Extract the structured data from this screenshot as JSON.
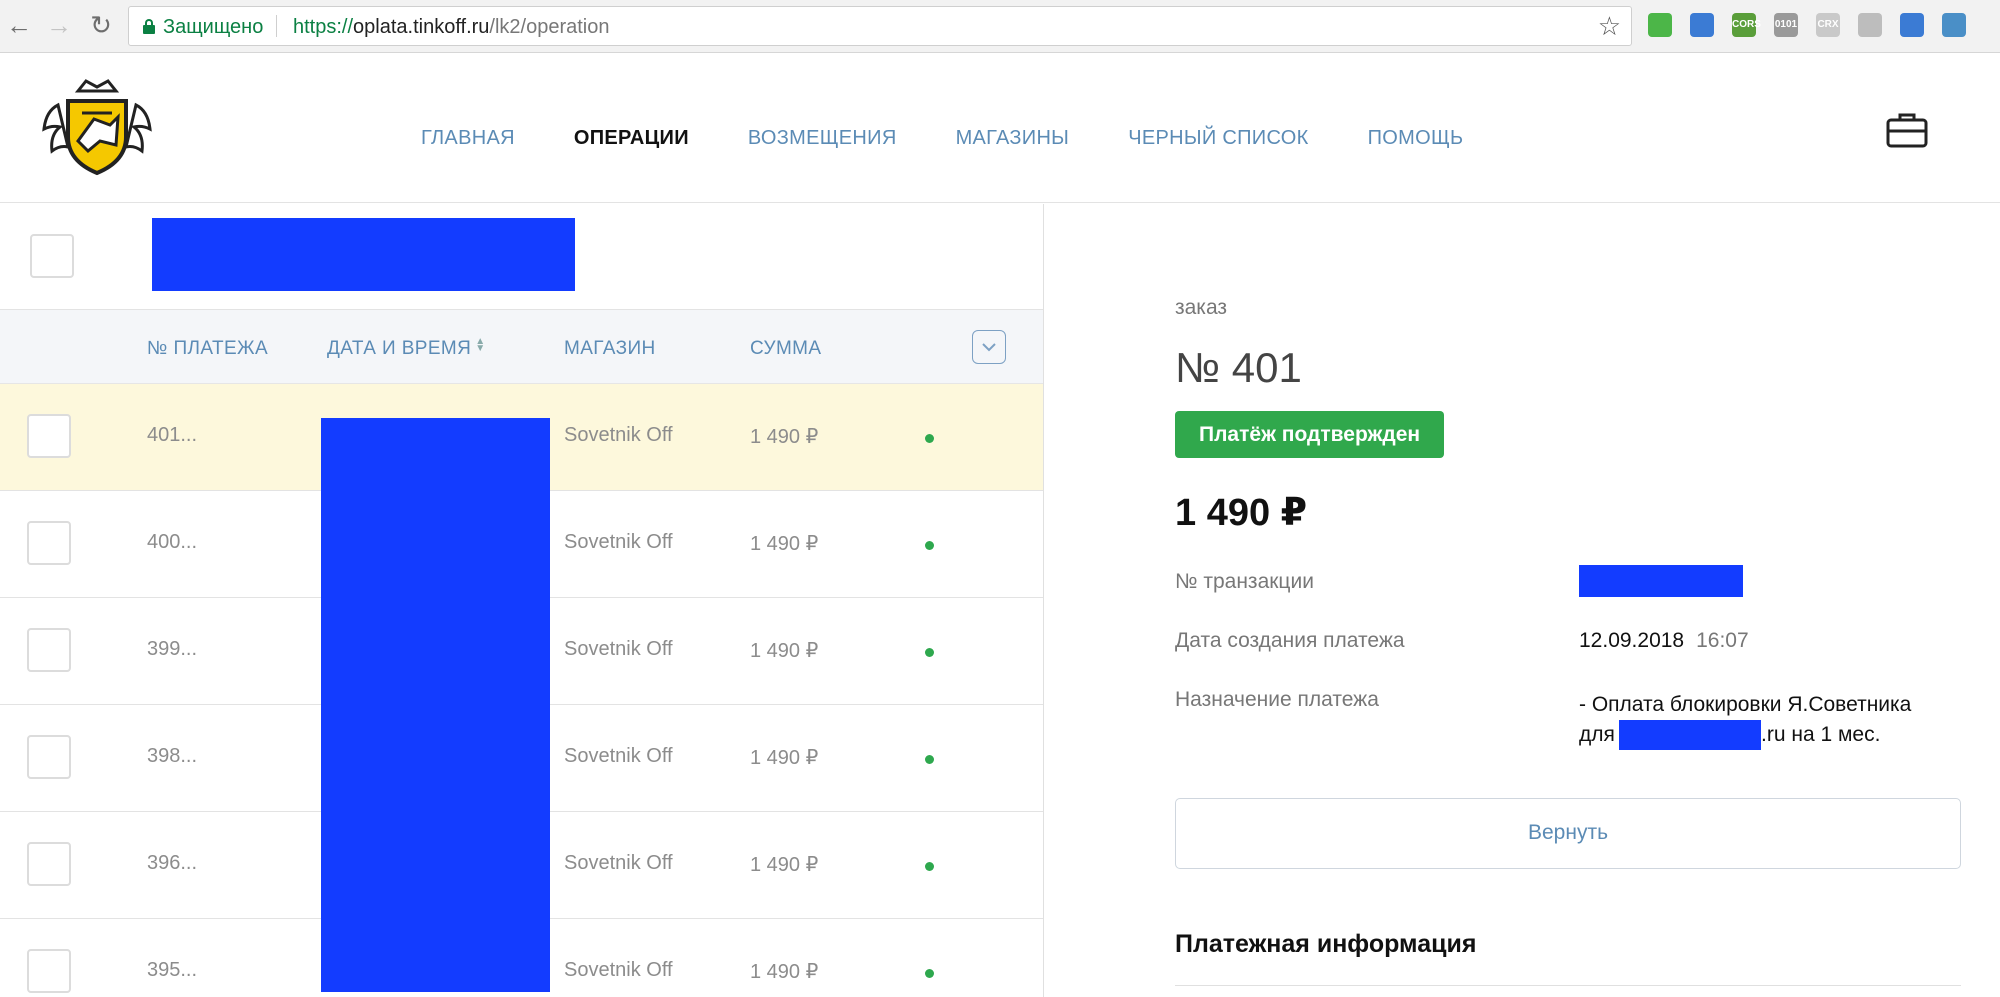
{
  "browser": {
    "secure_label": "Защищено",
    "url_scheme": "https://",
    "url_host": "oplata.tinkoff.ru",
    "url_path": "/lk2/operation",
    "extensions": [
      {
        "name": "green-extension-icon",
        "color": "#4cb648",
        "text": ""
      },
      {
        "name": "blue-block-extension-icon",
        "color": "#3b7bd4",
        "text": ""
      },
      {
        "name": "cors-extension-icon",
        "color": "#5a9e3a",
        "text": "CORS"
      },
      {
        "name": "binary-extension-icon",
        "color": "#9a9a9a",
        "text": "0101"
      },
      {
        "name": "crx-extension-icon",
        "color": "#c9c9c9",
        "text": "CRX"
      },
      {
        "name": "paw-extension-icon",
        "color": "#bdbdbd",
        "text": ""
      },
      {
        "name": "cart-extension-icon",
        "color": "#3b7bd4",
        "text": ""
      },
      {
        "name": "drop-extension-icon",
        "color": "#4a8fc7",
        "text": ""
      }
    ]
  },
  "header": {
    "nav": [
      {
        "label": "ГЛАВНАЯ",
        "active": false
      },
      {
        "label": "ОПЕРАЦИИ",
        "active": true
      },
      {
        "label": "ВОЗМЕЩЕНИЯ",
        "active": false
      },
      {
        "label": "МАГАЗИНЫ",
        "active": false
      },
      {
        "label": "ЧЕРНЫЙ СПИСОК",
        "active": false
      },
      {
        "label": "ПОМОЩЬ",
        "active": false
      }
    ]
  },
  "table": {
    "columns": {
      "payment_no": "№ ПЛАТЕЖА",
      "datetime": "ДАТА И ВРЕМЯ",
      "shop": "МАГАЗИН",
      "amount": "СУММА"
    },
    "rows": [
      {
        "id": "401...",
        "shop": "Sovetnik Off",
        "amount": "1 490 ₽",
        "selected": true
      },
      {
        "id": "400...",
        "shop": "Sovetnik Off",
        "amount": "1 490 ₽",
        "selected": false
      },
      {
        "id": "399...",
        "shop": "Sovetnik Off",
        "amount": "1 490 ₽",
        "selected": false
      },
      {
        "id": "398...",
        "shop": "Sovetnik Off",
        "amount": "1 490 ₽",
        "selected": false
      },
      {
        "id": "396...",
        "shop": "Sovetnik Off",
        "amount": "1 490 ₽",
        "selected": false
      },
      {
        "id": "395...",
        "shop": "Sovetnik Off",
        "amount": "1 490 ₽",
        "selected": false
      }
    ],
    "status_color": "#2ea84e",
    "redaction_color": "#133cff"
  },
  "details": {
    "order_label": "заказ",
    "order_number": "№ 401",
    "status": "Платёж подтвержден",
    "status_color": "#30a84c",
    "amount": "1 490 ₽",
    "transaction_label": "№ транзакции",
    "created_label": "Дата создания платежа",
    "created_date": "12.09.2018",
    "created_time": "16:07",
    "purpose_label": "Назначение платежа",
    "purpose_line1": "- Оплата блокировки Я.Советника",
    "purpose_line2_prefix": "для",
    "purpose_line2_suffix": ".ru на 1 мес.",
    "refund_label": "Вернуть",
    "section_title": "Платежная информация"
  }
}
